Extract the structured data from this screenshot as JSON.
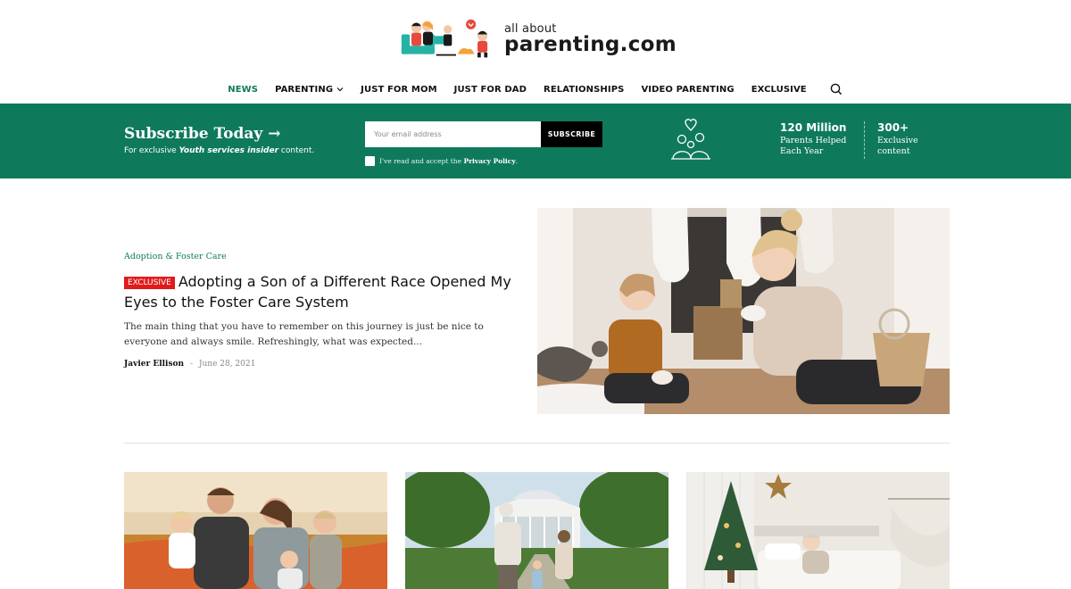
{
  "logo": {
    "small": "all about",
    "big": "parenting.com",
    "art_icon": "family-reading-illustration-icon"
  },
  "nav": {
    "items": [
      {
        "label": "NEWS",
        "active": true
      },
      {
        "label": "PARENTING",
        "dropdown": true
      },
      {
        "label": "JUST FOR MOM"
      },
      {
        "label": "JUST FOR DAD"
      },
      {
        "label": "RELATIONSHIPS"
      },
      {
        "label": "VIDEO PARENTING"
      },
      {
        "label": "EXCLUSIVE"
      }
    ],
    "search_icon": "search-icon"
  },
  "subscribe": {
    "title": "Subscribe Today →",
    "subtitle_pre": "For exclusive ",
    "subtitle_bold": "Youth services insider",
    "subtitle_post": " content.",
    "email_placeholder": "Your email address",
    "button": "SUBSCRIBE",
    "consent_pre": "I've read and accept the ",
    "consent_link": "Privacy Policy",
    "consent_post": ".",
    "stat1_value": "120 Million",
    "stat1_label_line1": "Parents Helped",
    "stat1_label_line2": "Each Year",
    "stat2_value": "300+",
    "stat2_label_line1": "Exclusive",
    "stat2_label_line2": "content",
    "band_color": "#0f7a5b"
  },
  "featured": {
    "category": "Adoption & Foster Care",
    "badge": "EXCLUSIVE",
    "title": "Adopting a Son of a Different Race Opened My Eyes to the Foster Care System",
    "excerpt": "The main thing that you have to remember on this journey is just be nice to everyone and always smile. Refreshingly, what was expected...",
    "author": "Javier Ellison",
    "separator": "-",
    "date": "June 28, 2021",
    "badge_color": "#e01b1b"
  },
  "thumbnails": [
    {
      "image": "family-field-photo"
    },
    {
      "image": "greenhouse-walk-photo"
    },
    {
      "image": "christmas-bedroom-photo"
    }
  ]
}
